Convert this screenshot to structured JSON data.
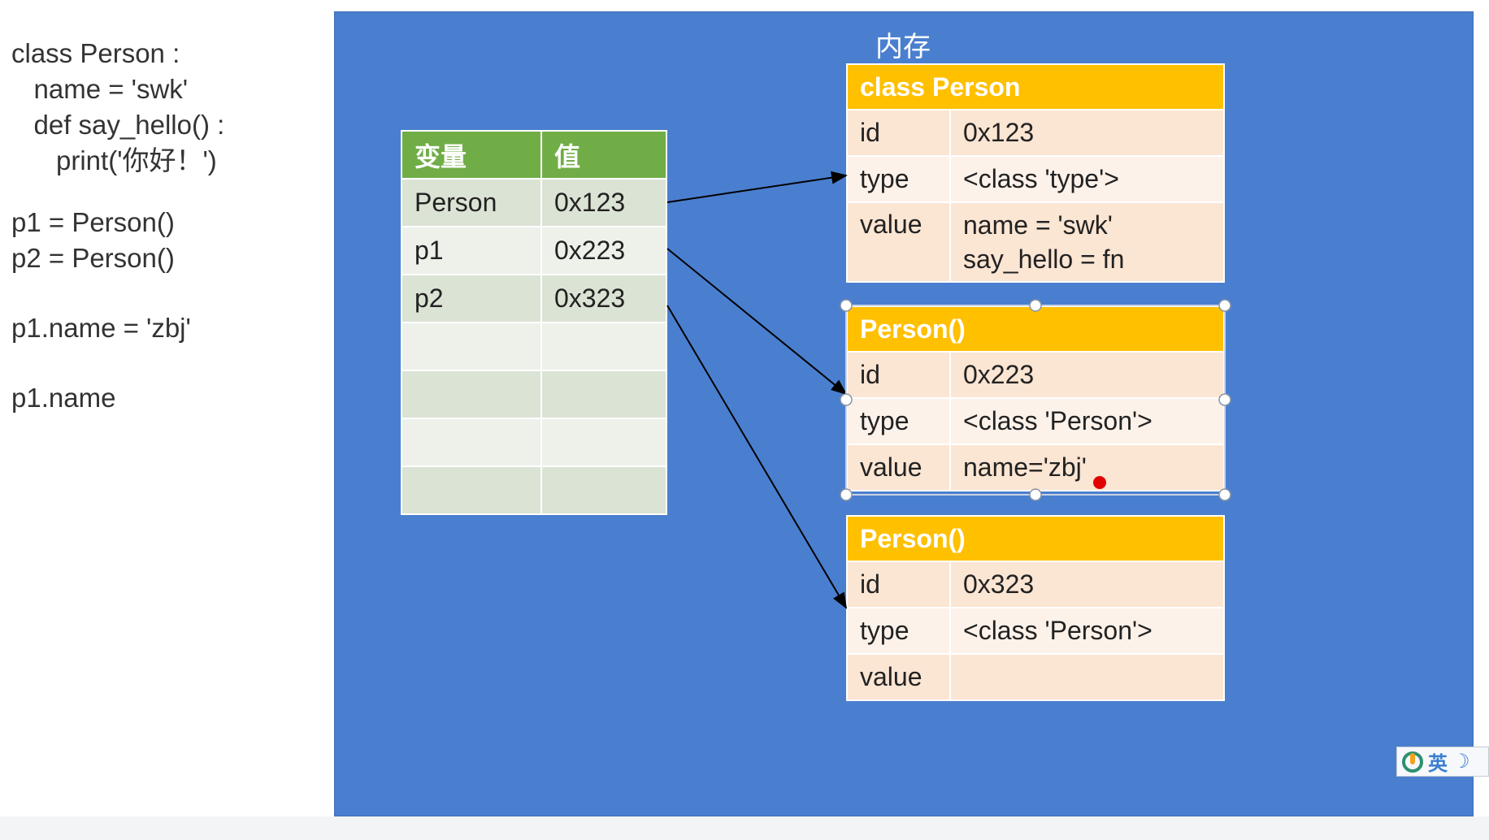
{
  "code_lines": [
    "class Person :",
    "   name = 'swk'",
    "   def say_hello() :",
    "      print('你好！')",
    "",
    "p1 = Person()",
    "p2 = Person()",
    "",
    "p1.name = 'zbj'",
    "",
    "p1.name"
  ],
  "memory_label": "内存",
  "var_table": {
    "headers": [
      "变量",
      "值"
    ],
    "rows": [
      [
        "Person",
        "0x123"
      ],
      [
        "p1",
        "0x223"
      ],
      [
        "p2",
        "0x323"
      ],
      [
        "",
        ""
      ],
      [
        "",
        ""
      ],
      [
        "",
        ""
      ],
      [
        "",
        ""
      ]
    ]
  },
  "objects": [
    {
      "title": "class Person",
      "id_label": "id",
      "id": "0x123",
      "type_label": "type",
      "type": "<class 'type'>",
      "value_label": "value",
      "value_lines": [
        "name = 'swk'",
        "say_hello = fn"
      ]
    },
    {
      "title": "Person()",
      "id_label": "id",
      "id": "0x223",
      "type_label": "type",
      "type": "<class 'Person'>",
      "value_label": "value",
      "value_lines": [
        "name='zbj'"
      ]
    },
    {
      "title": "Person()",
      "id_label": "id",
      "id": "0x323",
      "type_label": "type",
      "type": "<class 'Person'>",
      "value_label": "value",
      "value_lines": [
        ""
      ]
    }
  ],
  "ime": {
    "mode": "英",
    "icon": "moon-icon"
  },
  "colors": {
    "panel": "#4a7fcf",
    "var_header": "#70ad47",
    "obj_header": "#ffc000",
    "pointer": "#e00000"
  }
}
